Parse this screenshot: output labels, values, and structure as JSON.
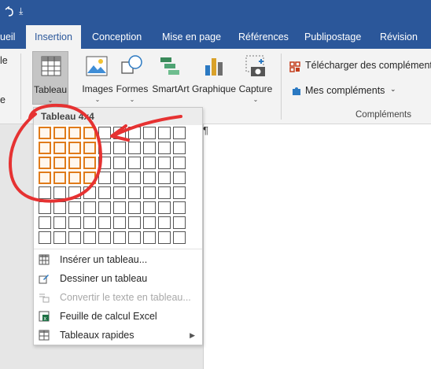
{
  "titlebar": {
    "qat": [
      "undo-icon",
      "redo-icon",
      "customize-qat-icon"
    ],
    "customize_glyph": "⤓"
  },
  "tabs": [
    "ueil",
    "Insertion",
    "Conception",
    "Mise en page",
    "Références",
    "Publipostage",
    "Révision"
  ],
  "active_tab": "Insertion",
  "ribbon": {
    "left_fragment_1": "le",
    "left_fragment_2": "e",
    "tableau": "Tableau",
    "images": "Images",
    "formes": "Formes",
    "smartart": "SmartArt",
    "graphique": "Graphique",
    "capture": "Capture",
    "telecharger": "Télécharger des compléments",
    "mes_complements": "Mes compléments",
    "group_complements": "Compléments"
  },
  "dropdown": {
    "header": "Tableau 4x4",
    "grid_cols": 10,
    "grid_rows": 8,
    "selected_cols": 4,
    "selected_rows": 4,
    "items": [
      {
        "label": "Insérer un tableau...",
        "icon": "insert-table-icon",
        "disabled": false
      },
      {
        "label": "Dessiner un tableau",
        "icon": "draw-table-icon",
        "disabled": false
      },
      {
        "label": "Convertir le texte en tableau...",
        "icon": "convert-text-icon",
        "disabled": true
      },
      {
        "label": "Feuille de calcul Excel",
        "icon": "excel-icon",
        "disabled": false
      },
      {
        "label": "Tableaux rapides",
        "icon": "quick-tables-icon",
        "disabled": false,
        "submenu": true
      }
    ]
  },
  "document": {
    "pilcrow": "¶"
  },
  "annotation_color": "#e63232",
  "accent": "#2b579a",
  "selection_color": "#e07b1a"
}
